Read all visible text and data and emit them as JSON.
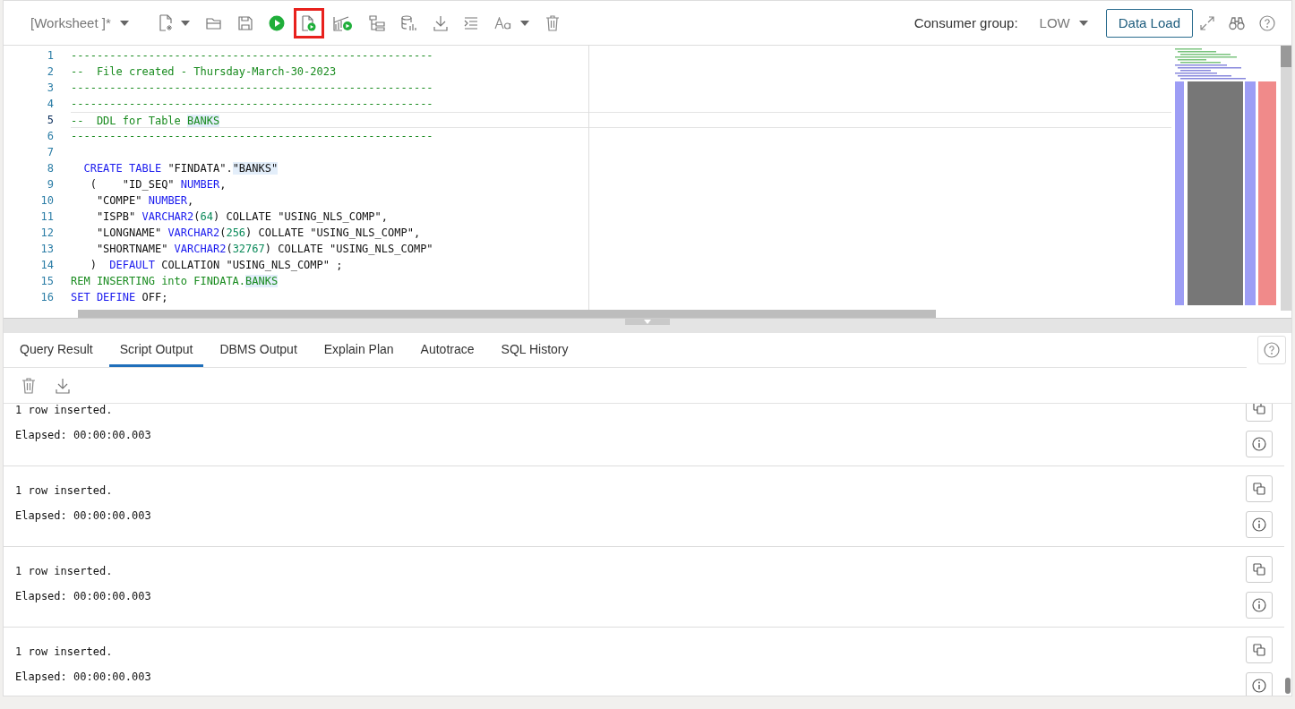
{
  "toolbar": {
    "worksheet": "[Worksheet ]*",
    "buttons": [
      {
        "kind": "new",
        "highlighted": false
      },
      {
        "kind": "open",
        "highlighted": false
      },
      {
        "kind": "save",
        "highlighted": false
      },
      {
        "kind": "run",
        "highlighted": false
      },
      {
        "kind": "runscript",
        "highlighted": true
      },
      {
        "kind": "autotrace",
        "highlighted": false
      },
      {
        "kind": "plan",
        "highlighted": false
      },
      {
        "kind": "db",
        "highlighted": false
      },
      {
        "kind": "download",
        "highlighted": false
      },
      {
        "kind": "format",
        "highlighted": false
      },
      {
        "kind": "font",
        "highlighted": false
      },
      {
        "kind": "trash",
        "highlighted": false
      }
    ],
    "consumer_group_label": "Consumer group:",
    "consumer_group": "LOW",
    "data_load": "Data Load"
  },
  "editor": {
    "lines": [
      {
        "number": "1",
        "current": false,
        "tokens": [
          {
            "kind": "comment",
            "t": "--------------------------------------------------------"
          }
        ]
      },
      {
        "number": "2",
        "current": false,
        "tokens": [
          {
            "kind": "comment",
            "t": "--  File created - Thursday-March-30-2023"
          }
        ]
      },
      {
        "number": "3",
        "current": false,
        "tokens": [
          {
            "kind": "comment",
            "t": "--------------------------------------------------------"
          }
        ]
      },
      {
        "number": "4",
        "current": false,
        "tokens": [
          {
            "kind": "comment",
            "t": "--------------------------------------------------------"
          }
        ]
      },
      {
        "number": "5",
        "current": true,
        "tokens": [
          {
            "kind": "comment",
            "t": "--  DDL for Table "
          },
          {
            "kind": "comment",
            "t": "BANKS",
            "match": true
          }
        ]
      },
      {
        "number": "6",
        "current": false,
        "tokens": [
          {
            "kind": "comment",
            "t": "--------------------------------------------------------"
          }
        ]
      },
      {
        "number": "7",
        "current": false
      },
      {
        "number": "8",
        "current": false,
        "tokens": [
          {
            "kind": "keyword",
            "t": "  CREATE TABLE"
          },
          {
            "kind": "text",
            "t": " \"FINDATA\"."
          },
          {
            "kind": "text",
            "t": "\"BANKS\"",
            "match": true
          }
        ]
      },
      {
        "number": "9",
        "current": false,
        "tokens": [
          {
            "kind": "text",
            "t": "   (    \"ID_SEQ\" "
          },
          {
            "kind": "keyword",
            "t": "NUMBER"
          },
          {
            "kind": "text",
            "t": ","
          }
        ]
      },
      {
        "number": "10",
        "current": false,
        "tokens": [
          {
            "kind": "text",
            "t": "    \"COMPE\" "
          },
          {
            "kind": "keyword",
            "t": "NUMBER"
          },
          {
            "kind": "text",
            "t": ","
          }
        ]
      },
      {
        "number": "11",
        "current": false,
        "tokens": [
          {
            "kind": "text",
            "t": "    \"ISPB\" "
          },
          {
            "kind": "keyword",
            "t": "VARCHAR2"
          },
          {
            "kind": "text",
            "t": "("
          },
          {
            "kind": "number",
            "t": "64"
          },
          {
            "kind": "text",
            "t": ") COLLATE \"USING_NLS_COMP\","
          }
        ]
      },
      {
        "number": "12",
        "current": false,
        "tokens": [
          {
            "kind": "text",
            "t": "    \"LONGNAME\" "
          },
          {
            "kind": "keyword",
            "t": "VARCHAR2"
          },
          {
            "kind": "text",
            "t": "("
          },
          {
            "kind": "number",
            "t": "256"
          },
          {
            "kind": "text",
            "t": ") COLLATE \"USING_NLS_COMP\","
          }
        ]
      },
      {
        "number": "13",
        "current": false,
        "tokens": [
          {
            "kind": "text",
            "t": "    \"SHORTNAME\" "
          },
          {
            "kind": "keyword",
            "t": "VARCHAR2"
          },
          {
            "kind": "text",
            "t": "("
          },
          {
            "kind": "number",
            "t": "32767"
          },
          {
            "kind": "text",
            "t": ") COLLATE \"USING_NLS_COMP\""
          }
        ]
      },
      {
        "number": "14",
        "current": false,
        "tokens": [
          {
            "kind": "text",
            "t": "   )  "
          },
          {
            "kind": "keyword",
            "t": "DEFAULT"
          },
          {
            "kind": "text",
            "t": " COLLATION \"USING_NLS_COMP\" ;"
          }
        ]
      },
      {
        "number": "15",
        "current": false,
        "tokens": [
          {
            "kind": "comment",
            "t": "REM INSERTING into FINDATA."
          },
          {
            "kind": "comment",
            "t": "BANKS",
            "match": true
          }
        ]
      },
      {
        "number": "16",
        "current": false,
        "tokens": [
          {
            "kind": "keyword",
            "t": "SET DEFINE"
          },
          {
            "kind": "text",
            "t": " OFF;"
          }
        ]
      }
    ]
  },
  "tabs": [
    {
      "label": "Query Result",
      "selected": false
    },
    {
      "label": "Script Output",
      "selected": true
    },
    {
      "label": "DBMS Output",
      "selected": false
    },
    {
      "label": "Explain Plan",
      "selected": false
    },
    {
      "label": "Autotrace",
      "selected": false
    },
    {
      "label": "SQL History",
      "selected": false
    }
  ],
  "output": [
    {
      "message": "1 row inserted.",
      "elapsed": "Elapsed: 00:00:00.003"
    },
    {
      "message": "1 row inserted.",
      "elapsed": "Elapsed: 00:00:00.003"
    },
    {
      "message": "1 row inserted.",
      "elapsed": "Elapsed: 00:00:00.003"
    },
    {
      "message": "1 row inserted.",
      "elapsed": "Elapsed: 00:00:00.003"
    }
  ]
}
